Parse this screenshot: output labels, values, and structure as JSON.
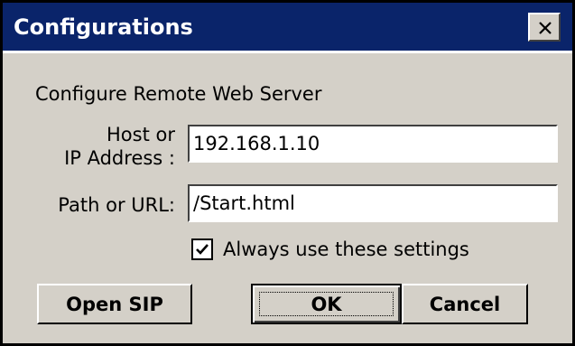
{
  "window": {
    "title": "Configurations",
    "close_icon": "close-icon"
  },
  "form": {
    "heading": "Configure Remote Web Server",
    "host_label_line1": "Host or",
    "host_label_line2": "IP Address :",
    "host_value": "192.168.1.10",
    "path_label": "Path or URL:",
    "path_value": "/Start.html",
    "always_use_label": "Always use these settings",
    "always_use_checked": true
  },
  "buttons": {
    "open_sip": "Open SIP",
    "ok": "OK",
    "cancel": "Cancel"
  },
  "colors": {
    "titlebar": "#0a246a",
    "face": "#d4d0c8"
  }
}
